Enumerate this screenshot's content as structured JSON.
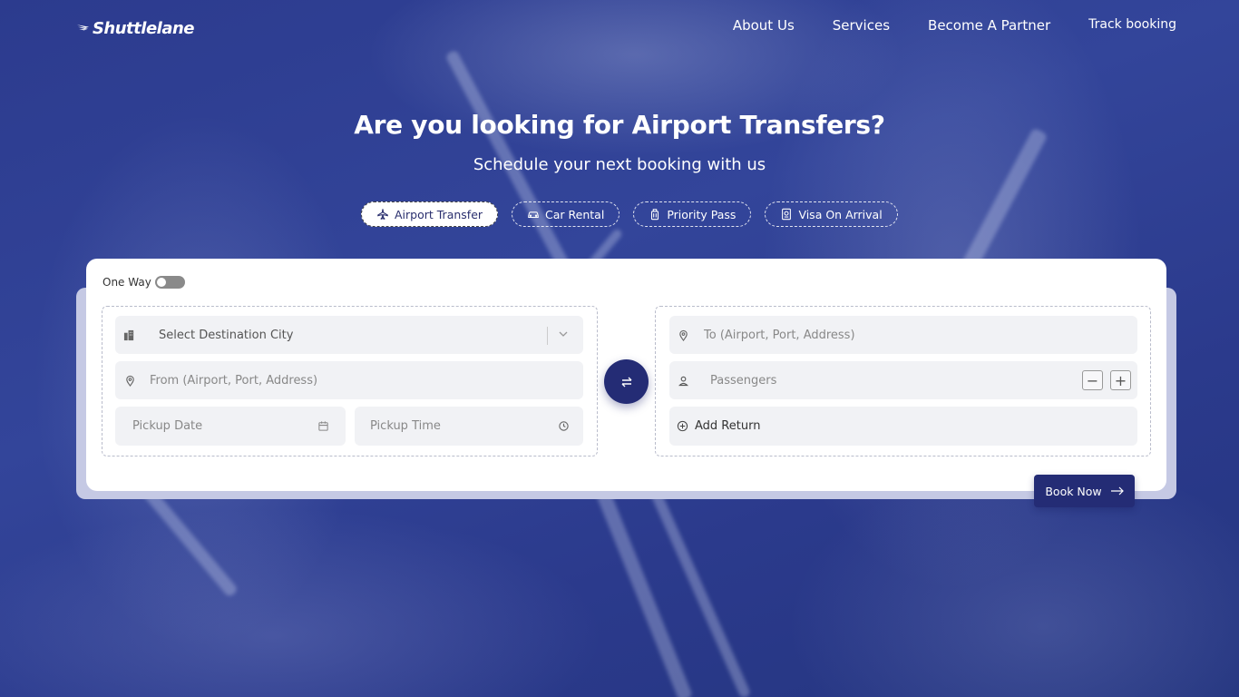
{
  "brand": {
    "logo_text": "Shuttlelane"
  },
  "nav": [
    {
      "label": "About Us"
    },
    {
      "label": "Services"
    },
    {
      "label": "Become A Partner"
    },
    {
      "label": "Track booking"
    }
  ],
  "hero": {
    "headline": "Are you looking for Airport Transfers?",
    "subheadline": "Schedule your next booking with us"
  },
  "tabs": [
    {
      "label": "Airport Transfer",
      "icon": "plane-icon",
      "active": true
    },
    {
      "label": "Car Rental",
      "icon": "car-icon",
      "active": false
    },
    {
      "label": "Priority Pass",
      "icon": "luggage-icon",
      "active": false
    },
    {
      "label": "Visa On Arrival",
      "icon": "passport-icon",
      "active": false
    }
  ],
  "form": {
    "one_way_label": "One Way",
    "one_way_on": false,
    "destination_city_placeholder": "Select Destination City",
    "from_placeholder": "From (Airport, Port, Address)",
    "pickup_date_placeholder": "Pickup Date",
    "pickup_time_placeholder": "Pickup Time",
    "to_placeholder": "To (Airport, Port, Address)",
    "passengers_placeholder": "Passengers",
    "add_return_label": "Add Return",
    "book_label": "Book Now"
  },
  "colors": {
    "primary": "#242c75",
    "hero_bg": "#2c3b8e",
    "field_bg": "#f1f2f5"
  }
}
